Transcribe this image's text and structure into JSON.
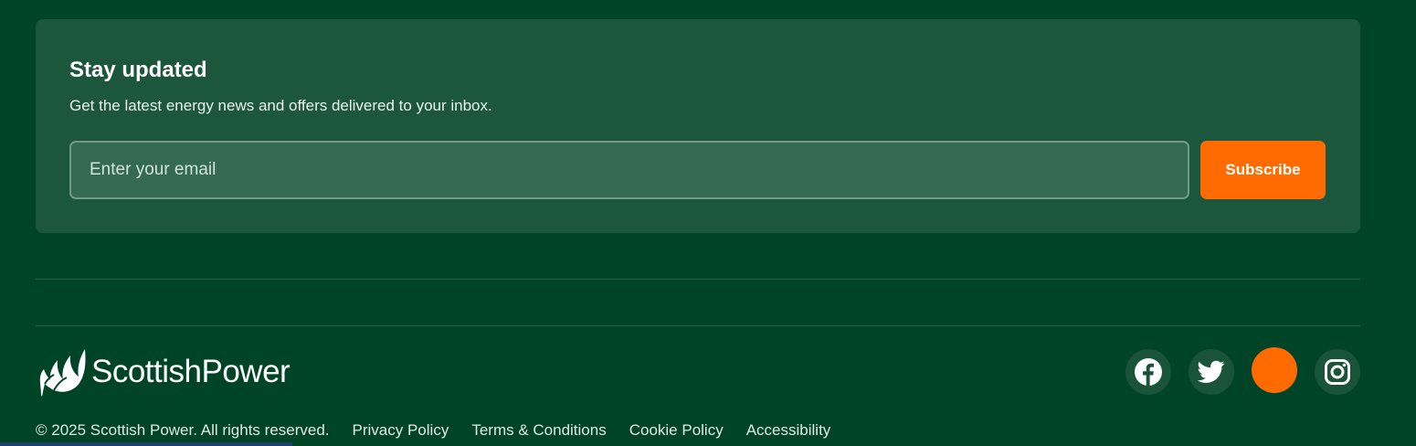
{
  "newsletter": {
    "title": "Stay updated",
    "description": "Get the latest energy news and offers delivered to your inbox.",
    "email_placeholder": "Enter your email",
    "email_value": "",
    "subscribe_label": "Subscribe"
  },
  "brand": {
    "name": "ScottishPower",
    "logo_icon": "flame-leaves-icon"
  },
  "social": [
    {
      "name": "facebook",
      "icon": "facebook-icon"
    },
    {
      "name": "twitter",
      "icon": "twitter-icon"
    },
    {
      "name": "highlighted-social",
      "icon": "circle-icon"
    },
    {
      "name": "instagram",
      "icon": "instagram-icon"
    }
  ],
  "footer": {
    "copyright": "© 2025 Scottish Power. All rights reserved.",
    "links": [
      "Privacy Policy",
      "Terms & Conditions",
      "Cookie Policy",
      "Accessibility"
    ]
  },
  "colors": {
    "background": "#004427",
    "card": "#1c563d",
    "accent": "#ff6b00",
    "input": "#346a52"
  }
}
